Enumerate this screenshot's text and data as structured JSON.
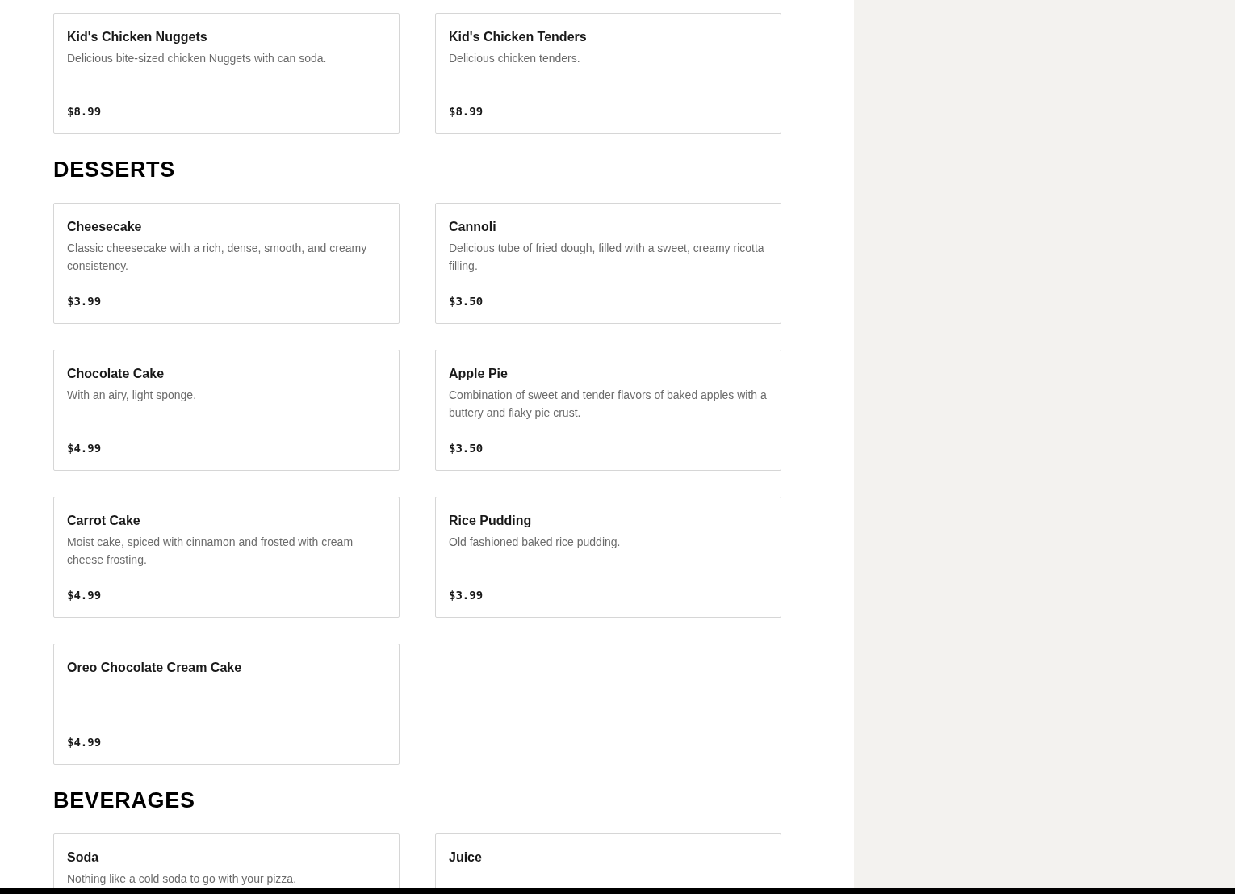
{
  "sections": [
    {
      "items": [
        {
          "name": "Kid's Chicken Nuggets",
          "description": "Delicious bite-sized chicken Nuggets with can soda.",
          "price": "$8.99"
        },
        {
          "name": "Kid's Chicken Tenders",
          "description": "Delicious chicken tenders.",
          "price": "$8.99"
        }
      ]
    },
    {
      "title": "DESSERTS",
      "items": [
        {
          "name": "Cheesecake",
          "description": "Classic cheesecake with a rich, dense, smooth, and creamy consistency.",
          "price": "$3.99"
        },
        {
          "name": "Cannoli",
          "description": "Delicious tube of fried dough, filled with a sweet, creamy ricotta filling.",
          "price": "$3.50"
        },
        {
          "name": "Chocolate Cake",
          "description": "With an airy, light sponge.",
          "price": "$4.99"
        },
        {
          "name": "Apple Pie",
          "description": "Combination of sweet and tender flavors of baked apples with a buttery and flaky pie crust.",
          "price": "$3.50"
        },
        {
          "name": "Carrot Cake",
          "description": "Moist cake, spiced with cinnamon and frosted with cream cheese frosting.",
          "price": "$4.99"
        },
        {
          "name": "Rice Pudding",
          "description": "Old fashioned baked rice pudding.",
          "price": "$3.99"
        },
        {
          "name": "Oreo Chocolate Cream Cake",
          "price": "$4.99"
        }
      ]
    },
    {
      "title": "BEVERAGES",
      "items": [
        {
          "name": "Soda",
          "description": "Nothing like a cold soda to go with your pizza."
        },
        {
          "name": "Juice"
        }
      ]
    }
  ]
}
